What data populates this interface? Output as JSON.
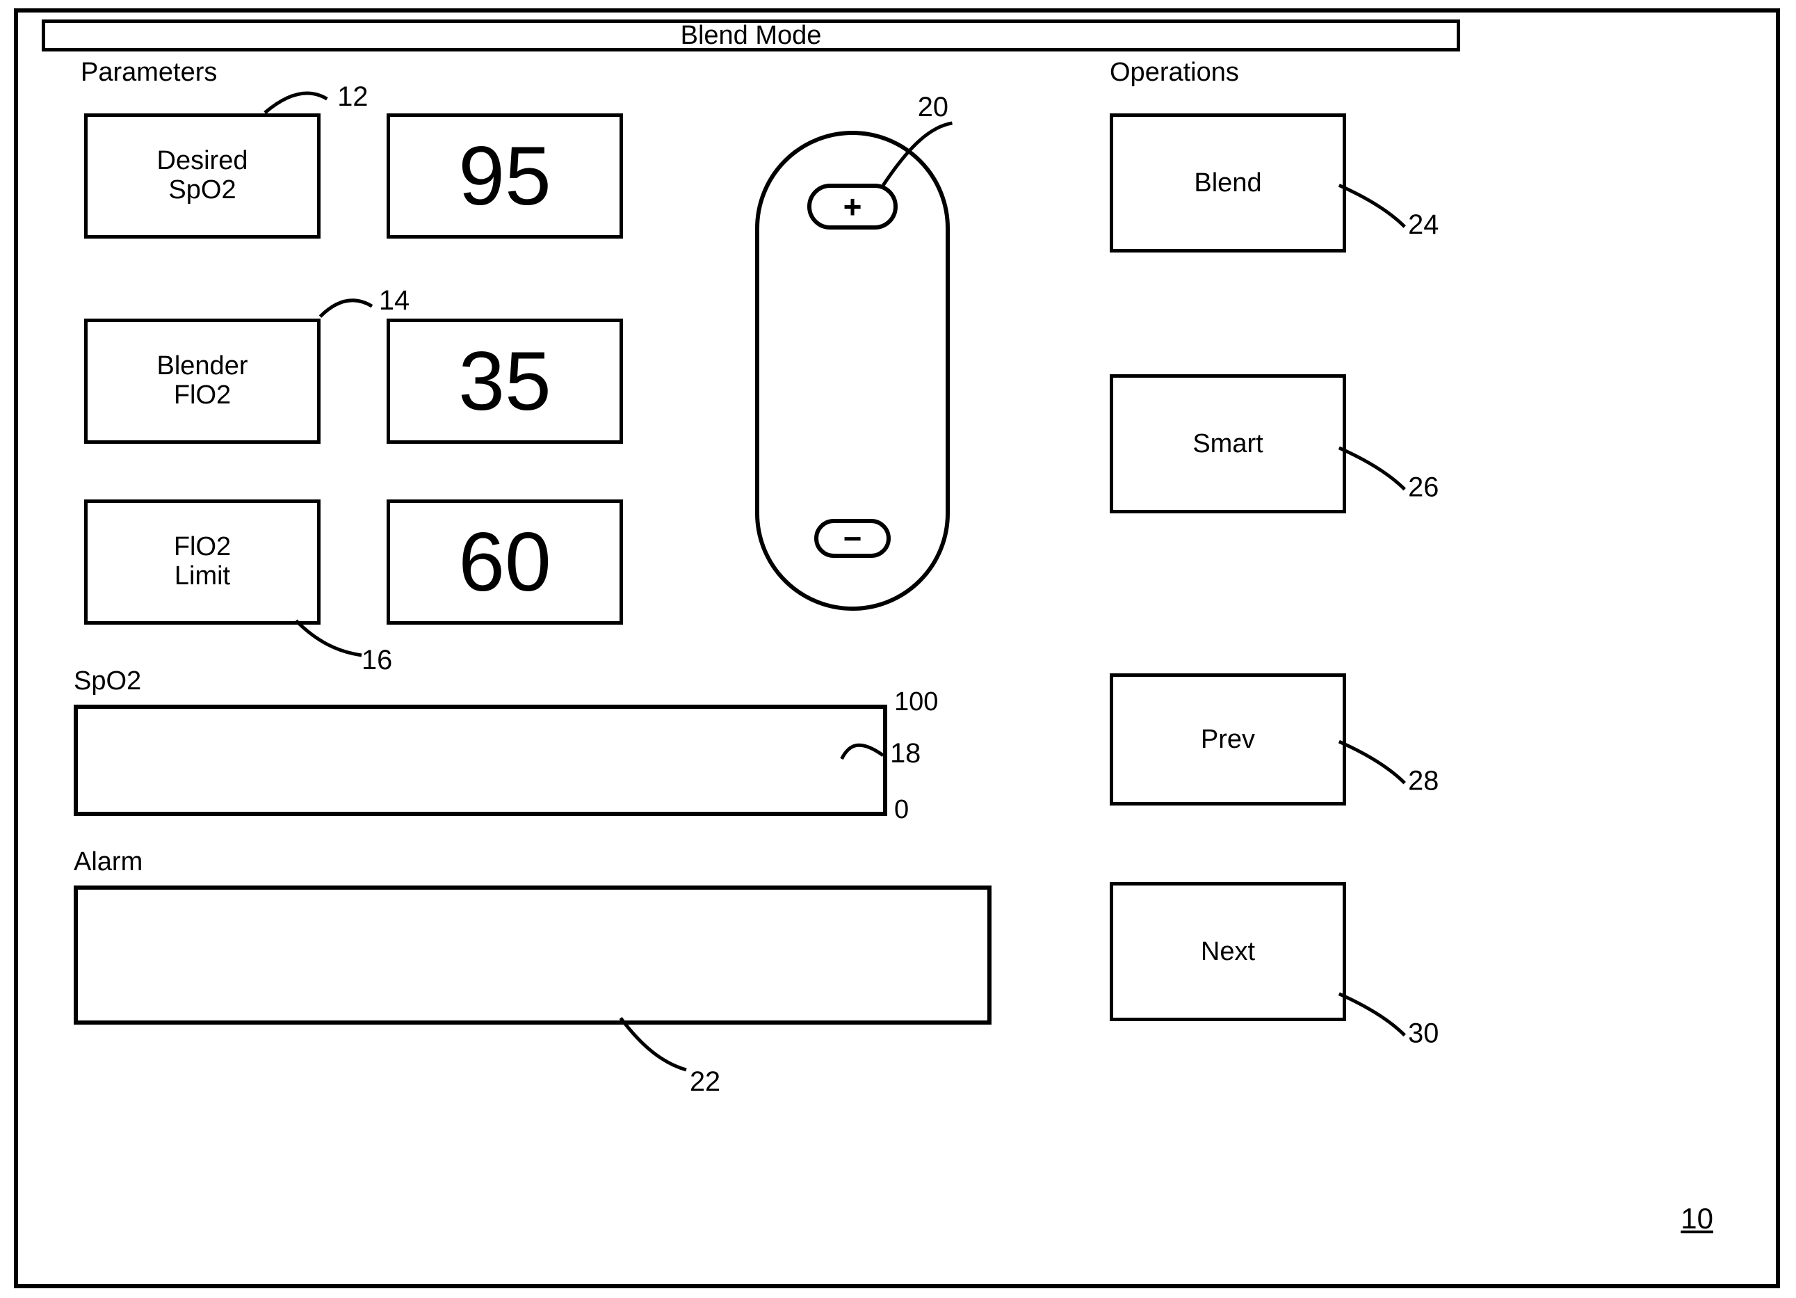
{
  "title": "Blend Mode",
  "sections": {
    "parameters_heading": "Parameters",
    "operations_heading": "Operations",
    "spo2_heading": "SpO2",
    "alarm_heading": "Alarm"
  },
  "parameters": {
    "desired_spo2": {
      "label_line1": "Desired",
      "label_line2": "SpO2",
      "value": "95"
    },
    "blender_fio2": {
      "label_line1": "Blender",
      "label_line2": "FlO2",
      "value": "35"
    },
    "fio2_limit": {
      "label_line1": "FlO2",
      "label_line2": "Limit",
      "value": "60"
    }
  },
  "rocker": {
    "plus": "+",
    "minus": "−"
  },
  "operations": {
    "blend": "Blend",
    "smart": "Smart",
    "prev": "Prev",
    "next": "Next"
  },
  "spo2_scale": {
    "max": "100",
    "min": "0"
  },
  "refs": {
    "r10": "10",
    "r12": "12",
    "r14": "14",
    "r16": "16",
    "r18": "18",
    "r20": "20",
    "r22": "22",
    "r24": "24",
    "r26": "26",
    "r28": "28",
    "r30": "30"
  }
}
